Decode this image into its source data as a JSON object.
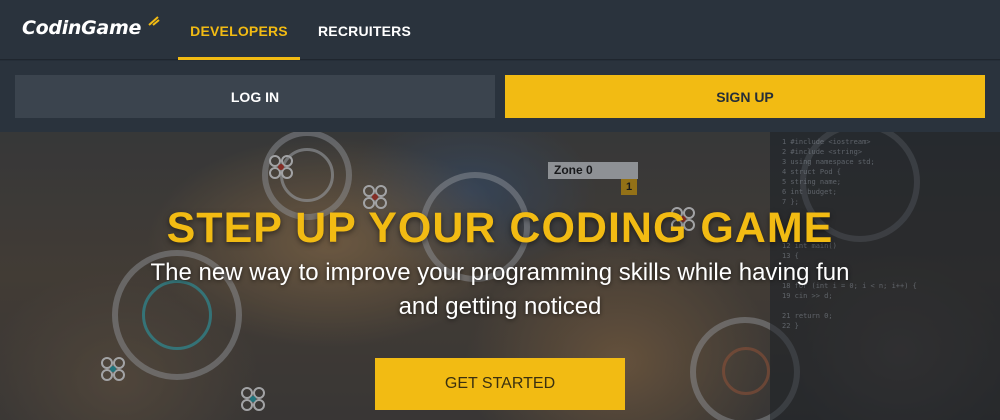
{
  "brand": {
    "name": "CodinGame",
    "accent": "#f2bb13",
    "background": "#2a333d"
  },
  "nav": {
    "tabs": [
      {
        "label": "DEVELOPERS",
        "active": true
      },
      {
        "label": "RECRUITERS",
        "active": false
      }
    ]
  },
  "auth": {
    "login_label": "LOG IN",
    "signup_label": "SIGN UP"
  },
  "hero": {
    "title": "STEP UP YOUR CODING GAME",
    "subtitle_line1": "The new way to improve your programming skills while having fun",
    "subtitle_line2": "and getting noticed",
    "cta_label": "GET STARTED",
    "game": {
      "zone_label": "Zone 0",
      "zone_count": "1"
    }
  },
  "icons": {
    "logo_spark": "spark-icon"
  }
}
